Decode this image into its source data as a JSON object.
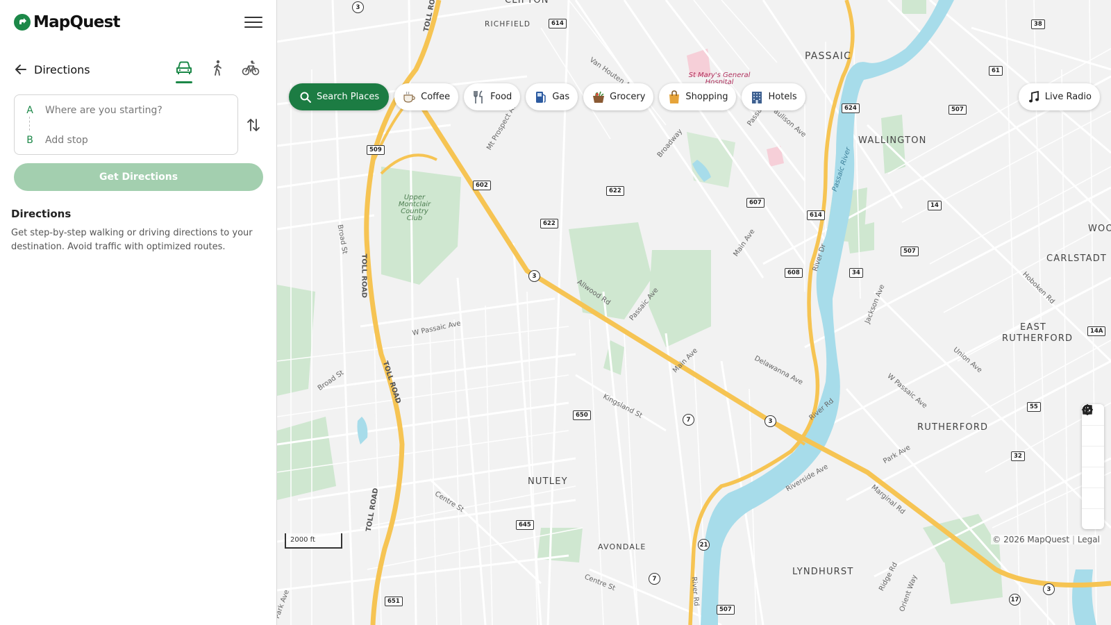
{
  "app": {
    "brand": "MapQuest"
  },
  "sidebar": {
    "header_title": "Directions",
    "modes": [
      "drive-icon",
      "walk-icon",
      "bike-icon"
    ],
    "origin": {
      "letter": "A",
      "placeholder": "Where are you starting?"
    },
    "stop": {
      "letter": "B",
      "placeholder": "Add stop"
    },
    "get_directions_label": "Get Directions",
    "info_title": "Directions",
    "info_text": "Get step-by-step walking or driving directions to your destination. Avoid traffic with optimized routes."
  },
  "chips": [
    {
      "label": "Search Places",
      "icon": "search-icon"
    },
    {
      "label": "Coffee",
      "icon": "coffee-icon"
    },
    {
      "label": "Food",
      "icon": "food-icon"
    },
    {
      "label": "Gas",
      "icon": "gas-icon"
    },
    {
      "label": "Grocery",
      "icon": "grocery-icon"
    },
    {
      "label": "Shopping",
      "icon": "shopping-icon"
    },
    {
      "label": "Hotels",
      "icon": "hotels-icon"
    }
  ],
  "live_radio_label": "Live Radio",
  "map": {
    "places": [
      "CLIFTON",
      "RICHFIELD",
      "PASSAIC",
      "WALLINGTON",
      "CARLSTADT",
      "EAST RUTHERFORD",
      "RUTHERFORD",
      "NUTLEY",
      "AVONDALE",
      "LYNDHURST",
      "WOO"
    ],
    "streets": [
      "TOLL ROAD",
      "TOLL ROAD",
      "TOLL ROAD",
      "TOLL ROAD",
      "W Passaic Ave",
      "Broad St",
      "Broad St",
      "Allwood Rd",
      "Passaic Ave",
      "Main Ave",
      "Kingsland St",
      "Centre St",
      "Centre St",
      "Delawanna Ave",
      "River Rd",
      "Riverside Ave",
      "Marginal Rd",
      "Park Ave",
      "Union Ave",
      "W Passaic Ave",
      "Jackson Ave",
      "Hoboken Rd",
      "River Dr",
      "Passaic River",
      "Main Ave",
      "Broadway",
      "Van Houten Ave",
      "Mt Prospect Ave",
      "Paulison Ave",
      "Passaic Ave",
      "Ridge Rd",
      "Orient Way",
      "River Rd",
      "Park Ave",
      "Upper Montclair Country Club",
      "St Mary's General Hospital"
    ],
    "shields": [
      "3",
      "614",
      "509",
      "602",
      "622",
      "622",
      "607",
      "614",
      "608",
      "34",
      "624",
      "507",
      "14",
      "507",
      "61",
      "38",
      "650",
      "7",
      "3",
      "645",
      "21",
      "7",
      "507",
      "651",
      "17",
      "3",
      "55",
      "32",
      "14A",
      "3"
    ],
    "scale_label": "2000 ft",
    "copyright": "© 2026 MapQuest",
    "legal": "Legal"
  }
}
